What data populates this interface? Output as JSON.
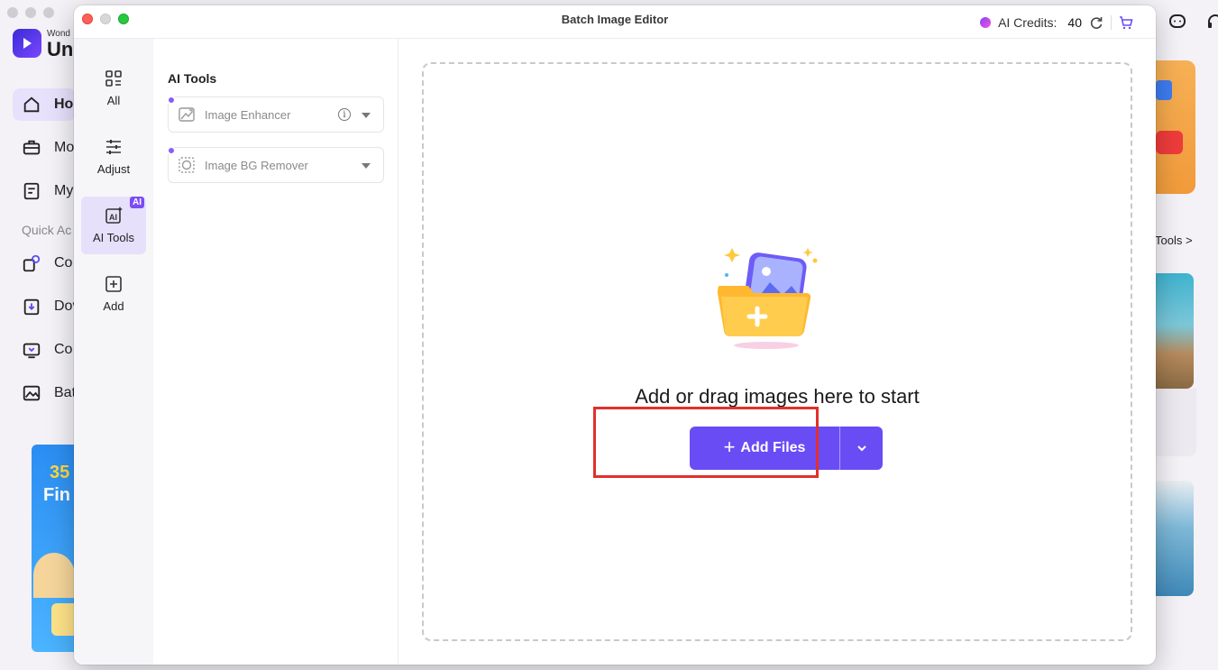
{
  "background_app": {
    "brand_small": "Wond",
    "brand": "Uni",
    "nav": [
      {
        "label": "Ho",
        "icon": "home-icon"
      },
      {
        "label": "Mo",
        "icon": "toolbox-icon"
      },
      {
        "label": "My",
        "icon": "file-icon"
      }
    ],
    "quick_access_label": "Quick Ac",
    "quick_nav": [
      {
        "label": "Co",
        "icon": "convert-icon"
      },
      {
        "label": "Dov",
        "icon": "download-icon"
      },
      {
        "label": "Co",
        "icon": "compress-icon"
      },
      {
        "label": "Bat",
        "icon": "image-icon"
      }
    ],
    "promo": {
      "line1": "35",
      "line2": "Fin"
    },
    "right_link": "Tools >"
  },
  "window": {
    "title": "Batch Image Editor",
    "credits_label": "AI Credits:",
    "credits_value": "40"
  },
  "rail": [
    {
      "label": "All",
      "icon": "grid-icon"
    },
    {
      "label": "Adjust",
      "icon": "sliders-icon"
    },
    {
      "label": "AI Tools",
      "icon": "ai-icon",
      "badge": "AI"
    },
    {
      "label": "Add",
      "icon": "plus-square-icon"
    }
  ],
  "panel": {
    "title": "AI Tools",
    "tools": [
      {
        "label": "Image Enhancer",
        "icon": "enhance-icon",
        "has_info": true,
        "info": "i"
      },
      {
        "label": "Image BG Remover",
        "icon": "bg-remove-icon",
        "has_info": false
      }
    ]
  },
  "dropzone": {
    "text": "Add or drag images here to start",
    "button_label": "Add Files",
    "button_plus": "+"
  },
  "colors": {
    "accent": "#6a4cf5",
    "highlight": "#e0302b",
    "rail_active": "#e6e0fb"
  }
}
